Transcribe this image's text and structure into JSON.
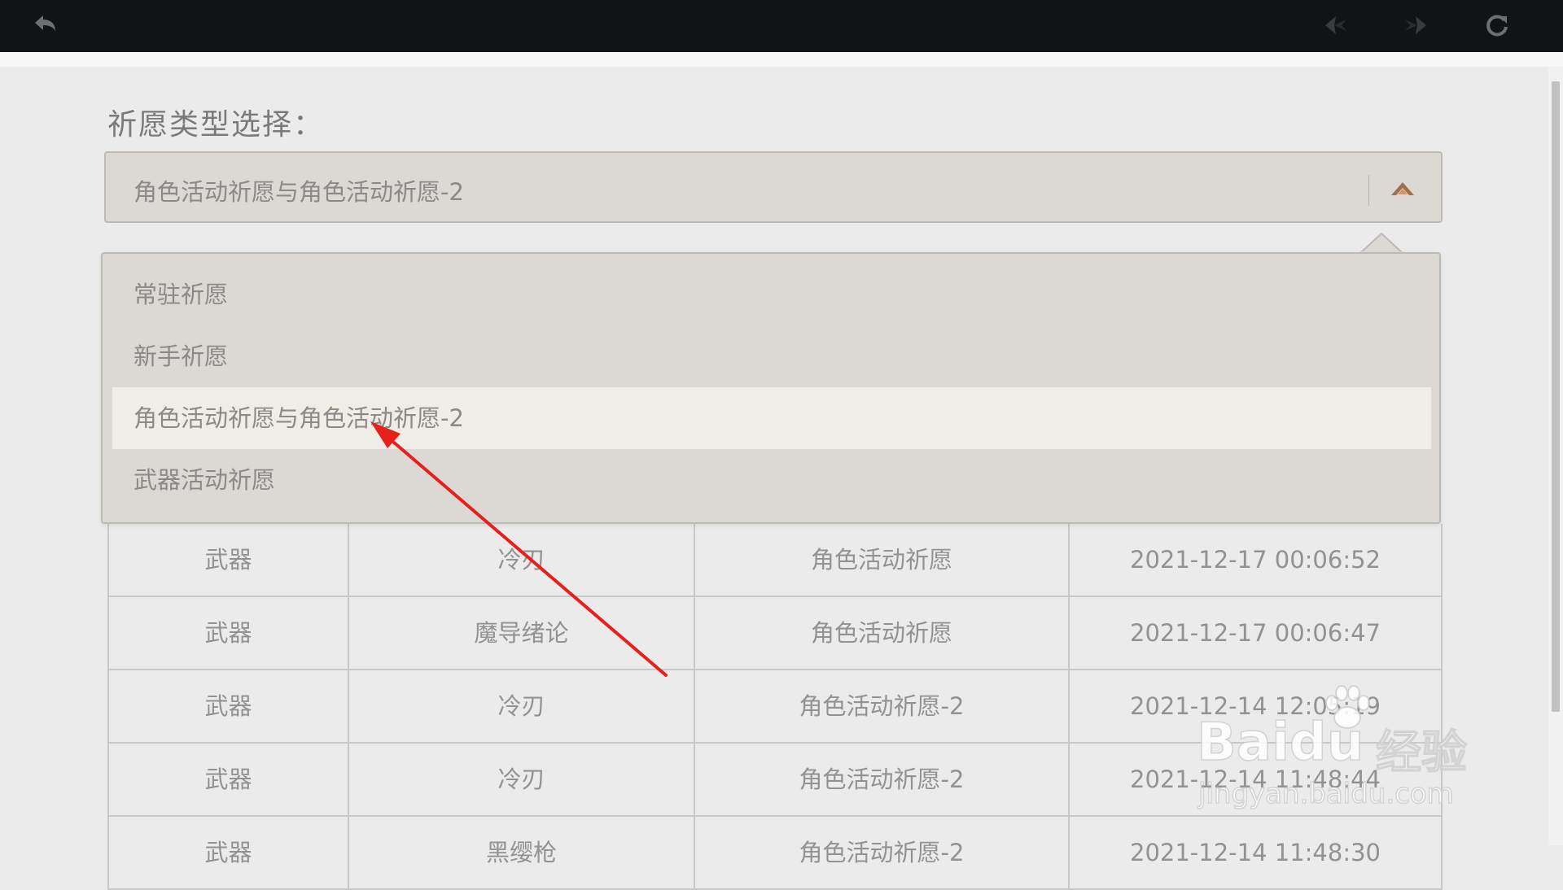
{
  "toolbar": {
    "back_icon": "undo-arrow-icon",
    "prev_icon": "diamond-left-icon",
    "next_icon": "diamond-right-icon",
    "refresh_icon": "refresh-icon"
  },
  "filter": {
    "label": "祈愿类型选择：",
    "selected_value": "角色活动祈愿与角色活动祈愿-2",
    "options": [
      "常驻祈愿",
      "新手祈愿",
      "角色活动祈愿与角色活动祈愿-2",
      "武器活动祈愿"
    ],
    "highlighted_index": 2
  },
  "table": {
    "rows": [
      [
        "武器",
        "冷刃",
        "角色活动祈愿",
        "2021-12-17 00:06:52"
      ],
      [
        "武器",
        "魔导绪论",
        "角色活动祈愿",
        "2021-12-17 00:06:47"
      ],
      [
        "武器",
        "冷刃",
        "角色活动祈愿-2",
        "2021-12-14 12:05:19"
      ],
      [
        "武器",
        "冷刃",
        "角色活动祈愿-2",
        "2021-12-14 11:48:44"
      ],
      [
        "武器",
        "黑缨枪",
        "角色活动祈愿-2",
        "2021-12-14 11:48:30"
      ]
    ]
  },
  "watermark": {
    "brand": "Baidu",
    "suffix": "经验",
    "url": "jingyan.baidu.com"
  },
  "colors": {
    "topbar": "#121317",
    "annotation_arrow": "#e8201b",
    "select_bg": "#dcd9d4",
    "option_highlight": "#f0ece6"
  }
}
